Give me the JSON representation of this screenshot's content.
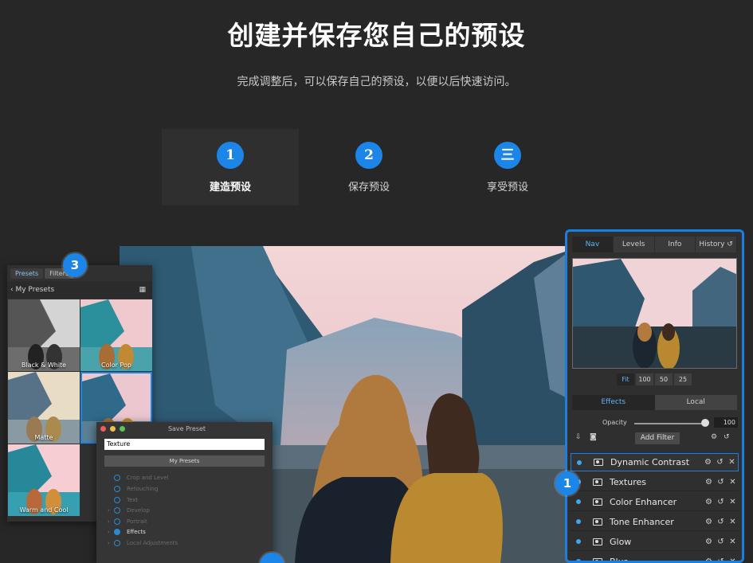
{
  "hero": {
    "title": "创建并保存您自己的预设",
    "subtitle": "完成调整后，可以保存自己的预设，以便以后快速访问。"
  },
  "steps": [
    {
      "number": "1",
      "label": "建造预设",
      "active": true
    },
    {
      "number": "2",
      "label": "保存预设",
      "active": false
    },
    {
      "number": "三",
      "label": "享受预设",
      "active": false
    }
  ],
  "colors": {
    "accent": "#1b86e8",
    "background": "#272727",
    "panel": "#2f2f2f"
  },
  "badges": {
    "left_panel": "3",
    "right_panel": "1"
  },
  "left_panel": {
    "tabs": [
      "Presets",
      "Filters"
    ],
    "back_label": "My Presets",
    "presets": [
      "Black & White",
      "Color Pop",
      "Matte",
      "",
      "Warm and Cool"
    ]
  },
  "save_dialog": {
    "title": "Save Preset",
    "name_value": "Texture",
    "category": "My Presets",
    "options": [
      {
        "label": "Crop and Level",
        "expandable": false,
        "checked": false
      },
      {
        "label": "Retouching",
        "expandable": false,
        "checked": false
      },
      {
        "label": "Text",
        "expandable": false,
        "checked": false
      },
      {
        "label": "Develop",
        "expandable": true,
        "checked": false
      },
      {
        "label": "Portrait",
        "expandable": true,
        "checked": false
      },
      {
        "label": "Effects",
        "expandable": true,
        "checked": true
      },
      {
        "label": "Local Adjustments",
        "expandable": true,
        "checked": false
      }
    ]
  },
  "right_panel": {
    "tabs": [
      "Nav",
      "Levels",
      "Info",
      "History"
    ],
    "zoom": [
      "Fit",
      "100",
      "50",
      "25"
    ],
    "effect_tabs": [
      "Effects",
      "Local"
    ],
    "opacity_label": "Opacity",
    "opacity_value": "100",
    "add_filter": "Add Filter",
    "effects": [
      "Dynamic Contrast",
      "Textures",
      "Color Enhancer",
      "Tone Enhancer",
      "Glow",
      "Blur"
    ]
  }
}
